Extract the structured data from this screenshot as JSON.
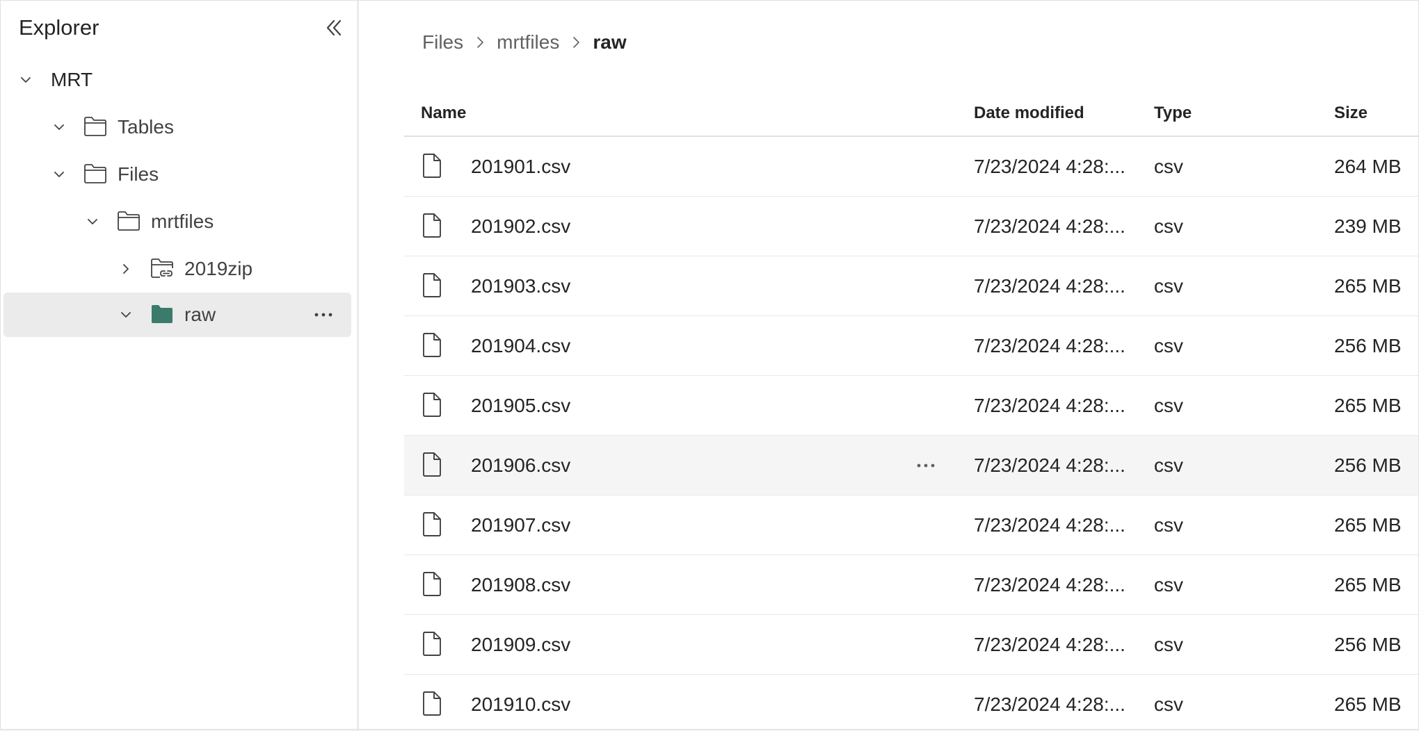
{
  "sidebar": {
    "title": "Explorer",
    "tree": [
      {
        "label": "MRT"
      },
      {
        "label": "Tables"
      },
      {
        "label": "Files"
      },
      {
        "label": "mrtfiles"
      },
      {
        "label": "2019zip"
      },
      {
        "label": "raw"
      }
    ]
  },
  "breadcrumb": [
    "Files",
    "mrtfiles",
    "raw"
  ],
  "table": {
    "columns": [
      "Name",
      "Date modified",
      "Type",
      "Size"
    ],
    "rows": [
      {
        "name": "201901.csv",
        "date": "7/23/2024 4:28:...",
        "type": "csv",
        "size": "264 MB"
      },
      {
        "name": "201902.csv",
        "date": "7/23/2024 4:28:...",
        "type": "csv",
        "size": "239 MB"
      },
      {
        "name": "201903.csv",
        "date": "7/23/2024 4:28:...",
        "type": "csv",
        "size": "265 MB"
      },
      {
        "name": "201904.csv",
        "date": "7/23/2024 4:28:...",
        "type": "csv",
        "size": "256 MB"
      },
      {
        "name": "201905.csv",
        "date": "7/23/2024 4:28:...",
        "type": "csv",
        "size": "265 MB"
      },
      {
        "name": "201906.csv",
        "date": "7/23/2024 4:28:...",
        "type": "csv",
        "size": "256 MB"
      },
      {
        "name": "201907.csv",
        "date": "7/23/2024 4:28:...",
        "type": "csv",
        "size": "265 MB"
      },
      {
        "name": "201908.csv",
        "date": "7/23/2024 4:28:...",
        "type": "csv",
        "size": "265 MB"
      },
      {
        "name": "201909.csv",
        "date": "7/23/2024 4:28:...",
        "type": "csv",
        "size": "256 MB"
      },
      {
        "name": "201910.csv",
        "date": "7/23/2024 4:28:...",
        "type": "csv",
        "size": "265 MB"
      }
    ]
  },
  "colors": {
    "accent_folder": "#3b7b6b",
    "selected_bg": "#ebebeb",
    "hover_bg": "#f5f5f5"
  },
  "icons": {
    "collapse": "double-chevron-left-icon",
    "expand": "chevron-down-icon",
    "collapsed": "chevron-right-icon",
    "folder": "folder-icon",
    "shortcut_folder": "folder-link-icon",
    "file": "document-icon",
    "more": "more-horizontal-icon"
  }
}
